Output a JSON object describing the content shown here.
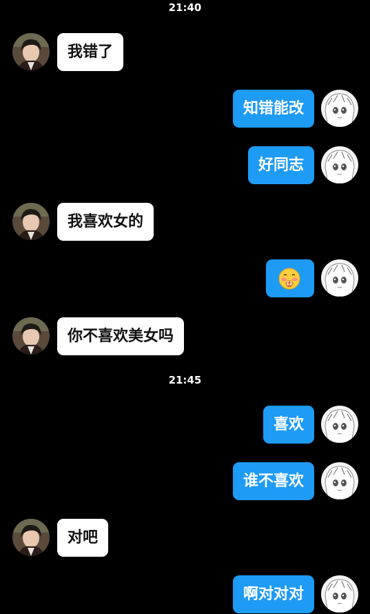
{
  "timestamps": [
    "21:40",
    "21:45"
  ],
  "messages": [
    {
      "side": "left",
      "text": "我错了"
    },
    {
      "side": "right",
      "text": "知错能改"
    },
    {
      "side": "right",
      "text": "好同志"
    },
    {
      "side": "left",
      "text": "我喜欢女的"
    },
    {
      "side": "right",
      "sticker": "blushing-face-emoji"
    },
    {
      "side": "left",
      "text": "你不喜欢美女吗"
    },
    {
      "side": "right",
      "text": "喜欢"
    },
    {
      "side": "right",
      "text": "谁不喜欢"
    },
    {
      "side": "left",
      "text": "对吧"
    },
    {
      "side": "right",
      "text": "啊对对对"
    }
  ],
  "colors": {
    "background": "#000000",
    "outgoing_bubble": "#1e9bf5",
    "incoming_bubble": "#ffffff"
  },
  "avatars": {
    "left": "dark-haired-boy-avatar",
    "right": "manga-girl-avatar"
  }
}
